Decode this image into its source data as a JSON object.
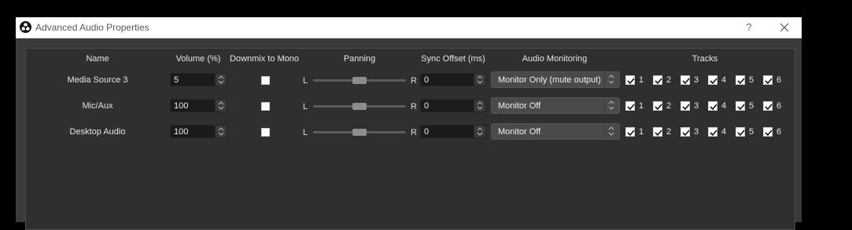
{
  "window": {
    "title": "Advanced Audio Properties",
    "help_label": "?"
  },
  "headers": {
    "name": "Name",
    "volume": "Volume (%)",
    "downmix": "Downmix to Mono",
    "panning": "Panning",
    "sync": "Sync Offset (ms)",
    "monitoring": "Audio Monitoring",
    "tracks": "Tracks"
  },
  "pan_labels": {
    "left": "L",
    "right": "R"
  },
  "rows": [
    {
      "name": "Media Source 3",
      "volume": "5",
      "downmix": false,
      "pan": 0.5,
      "sync": "0",
      "monitoring": "Monitor Only (mute output)",
      "tracks": [
        {
          "label": "1",
          "checked": true
        },
        {
          "label": "2",
          "checked": true
        },
        {
          "label": "3",
          "checked": true
        },
        {
          "label": "4",
          "checked": true
        },
        {
          "label": "5",
          "checked": true
        },
        {
          "label": "6",
          "checked": true
        }
      ]
    },
    {
      "name": "Mic/Aux",
      "volume": "100",
      "downmix": false,
      "pan": 0.5,
      "sync": "0",
      "monitoring": "Monitor Off",
      "tracks": [
        {
          "label": "1",
          "checked": true
        },
        {
          "label": "2",
          "checked": true
        },
        {
          "label": "3",
          "checked": true
        },
        {
          "label": "4",
          "checked": true
        },
        {
          "label": "5",
          "checked": true
        },
        {
          "label": "6",
          "checked": true
        }
      ]
    },
    {
      "name": "Desktop Audio",
      "volume": "100",
      "downmix": false,
      "pan": 0.5,
      "sync": "0",
      "monitoring": "Monitor Off",
      "tracks": [
        {
          "label": "1",
          "checked": true
        },
        {
          "label": "2",
          "checked": true
        },
        {
          "label": "3",
          "checked": true
        },
        {
          "label": "4",
          "checked": true
        },
        {
          "label": "5",
          "checked": true
        },
        {
          "label": "6",
          "checked": true
        }
      ]
    }
  ],
  "colors": {
    "window_bg": "#3a3a3a",
    "panel_bg": "#2f2f2f",
    "titlebar_bg": "#ffffff"
  }
}
